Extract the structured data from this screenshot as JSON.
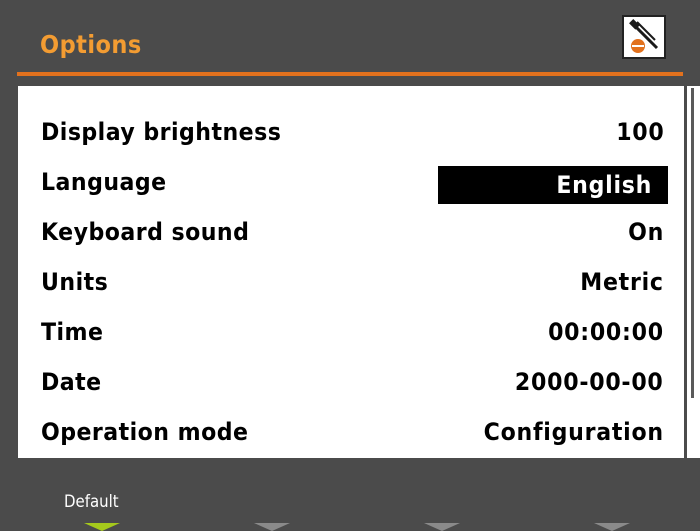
{
  "header": {
    "title": "Options",
    "icon": "settings-tools-icon",
    "accent_color": "#e2711d",
    "title_color": "#f39c32"
  },
  "options": [
    {
      "label": "Display brightness",
      "value": "100"
    },
    {
      "label": "Language",
      "value": "English",
      "selected": true
    },
    {
      "label": "Keyboard sound",
      "value": "On"
    },
    {
      "label": "Units",
      "value": "Metric"
    },
    {
      "label": "Time",
      "value": "00:00:00"
    },
    {
      "label": "Date",
      "value": "2000-00-00"
    },
    {
      "label": "Operation mode",
      "value": "Configuration"
    }
  ],
  "softkeys": {
    "key1_label": "Default",
    "active_color": "#a5c91c",
    "inactive_color": "#8a8a8a"
  }
}
